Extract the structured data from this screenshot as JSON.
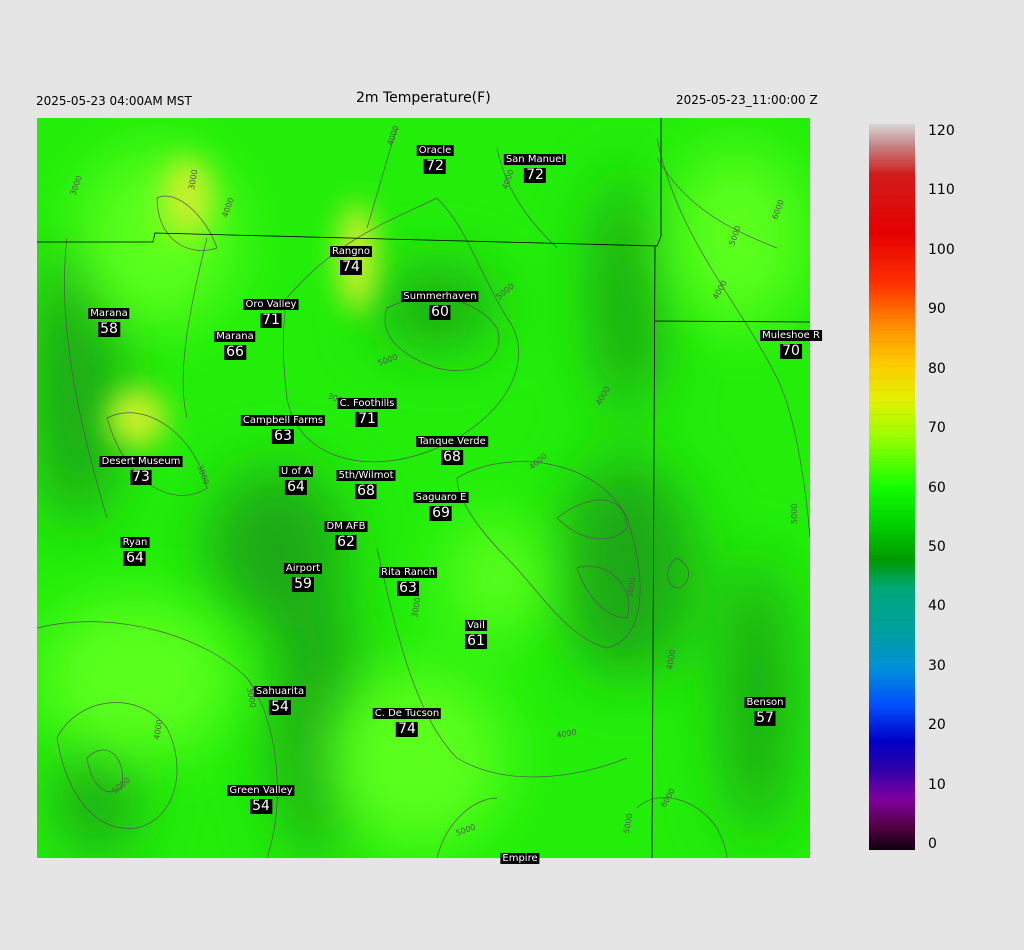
{
  "header": {
    "local_time": "2025-05-23 04:00AM MST",
    "title": "2m Temperature(F)",
    "utc_time": "2025-05-23_11:00:00 Z"
  },
  "colorbar": {
    "labels": [
      "120",
      "110",
      "100",
      "90",
      "80",
      "70",
      "60",
      "50",
      "40",
      "30",
      "20",
      "10",
      "0"
    ],
    "stops": [
      {
        "t": 0,
        "c": "#d8d8d8"
      },
      {
        "t": 3,
        "c": "#c68383"
      },
      {
        "t": 7,
        "c": "#d21c1c"
      },
      {
        "t": 15,
        "c": "#e60000"
      },
      {
        "t": 22,
        "c": "#ff3000"
      },
      {
        "t": 28,
        "c": "#ff9000"
      },
      {
        "t": 33,
        "c": "#ffcc00"
      },
      {
        "t": 38,
        "c": "#e3f000"
      },
      {
        "t": 43,
        "c": "#9cff00"
      },
      {
        "t": 50,
        "c": "#14ff00"
      },
      {
        "t": 55,
        "c": "#00d200"
      },
      {
        "t": 60,
        "c": "#009a00"
      },
      {
        "t": 64,
        "c": "#00a878"
      },
      {
        "t": 70,
        "c": "#00a0a0"
      },
      {
        "t": 75,
        "c": "#0090d8"
      },
      {
        "t": 80,
        "c": "#0050ff"
      },
      {
        "t": 85,
        "c": "#0000c8"
      },
      {
        "t": 89,
        "c": "#3000a8"
      },
      {
        "t": 93,
        "c": "#8000a0"
      },
      {
        "t": 97,
        "c": "#500040"
      },
      {
        "t": 100,
        "c": "#100010"
      }
    ]
  },
  "map": {
    "colors": {
      "base": "#22ee0a",
      "light": "#5cff1e",
      "dark": "#1aa812",
      "warm": "#c8f02a",
      "boundary": "#000000",
      "contour": "#555555"
    },
    "contour_labels": [
      "3000",
      "4000",
      "5000",
      "6000"
    ],
    "stations": [
      {
        "name": "Oracle",
        "value": "72"
      },
      {
        "name": "San Manuel",
        "value": "72"
      },
      {
        "name": "Rangno",
        "value": "74"
      },
      {
        "name": "Oro Valley",
        "value": "71"
      },
      {
        "name": "Summerhaven",
        "value": "60"
      },
      {
        "name": "Marana",
        "value": "58"
      },
      {
        "name": "Marana",
        "value": "66"
      },
      {
        "name": "Muleshoe R",
        "value": "70"
      },
      {
        "name": "C. Foothills",
        "value": "71"
      },
      {
        "name": "Campbell Farms",
        "value": "63"
      },
      {
        "name": "Tanque Verde",
        "value": "68"
      },
      {
        "name": "Desert Museum",
        "value": "73"
      },
      {
        "name": "U of A",
        "value": "64"
      },
      {
        "name": "5th/Wilmot",
        "value": "68"
      },
      {
        "name": "Saguaro E",
        "value": "69"
      },
      {
        "name": "DM AFB",
        "value": "62"
      },
      {
        "name": "Ryan",
        "value": "64"
      },
      {
        "name": "Airport",
        "value": "59"
      },
      {
        "name": "Rita Ranch",
        "value": "63"
      },
      {
        "name": "Vail",
        "value": "61"
      },
      {
        "name": "Sahuarita",
        "value": "54"
      },
      {
        "name": "C. De Tucson",
        "value": "74"
      },
      {
        "name": "Benson",
        "value": "57"
      },
      {
        "name": "Green Valley",
        "value": "54"
      },
      {
        "name": "Empire",
        "value": ""
      }
    ]
  }
}
